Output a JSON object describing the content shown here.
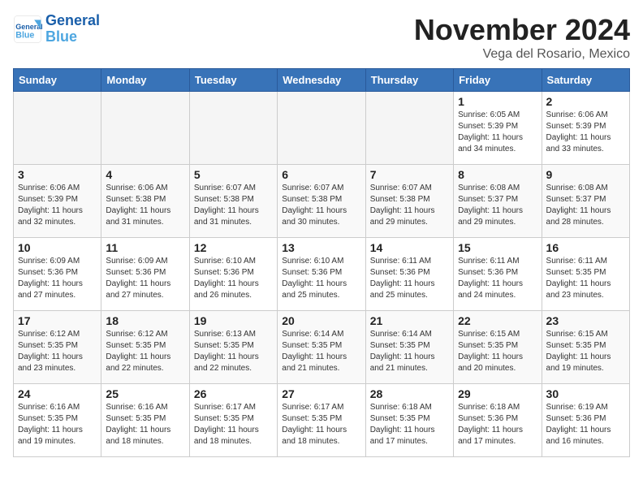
{
  "header": {
    "logo_line1": "General",
    "logo_line2": "Blue",
    "month_title": "November 2024",
    "location": "Vega del Rosario, Mexico"
  },
  "days_of_week": [
    "Sunday",
    "Monday",
    "Tuesday",
    "Wednesday",
    "Thursday",
    "Friday",
    "Saturday"
  ],
  "weeks": [
    {
      "row_class": "row-white",
      "days": [
        {
          "date": "",
          "empty": true
        },
        {
          "date": "",
          "empty": true
        },
        {
          "date": "",
          "empty": true
        },
        {
          "date": "",
          "empty": true
        },
        {
          "date": "",
          "empty": true
        },
        {
          "date": "1",
          "sunrise": "Sunrise: 6:05 AM",
          "sunset": "Sunset: 5:39 PM",
          "daylight": "Daylight: 11 hours and 34 minutes."
        },
        {
          "date": "2",
          "sunrise": "Sunrise: 6:06 AM",
          "sunset": "Sunset: 5:39 PM",
          "daylight": "Daylight: 11 hours and 33 minutes."
        }
      ]
    },
    {
      "row_class": "row-gray",
      "days": [
        {
          "date": "3",
          "sunrise": "Sunrise: 6:06 AM",
          "sunset": "Sunset: 5:39 PM",
          "daylight": "Daylight: 11 hours and 32 minutes."
        },
        {
          "date": "4",
          "sunrise": "Sunrise: 6:06 AM",
          "sunset": "Sunset: 5:38 PM",
          "daylight": "Daylight: 11 hours and 31 minutes."
        },
        {
          "date": "5",
          "sunrise": "Sunrise: 6:07 AM",
          "sunset": "Sunset: 5:38 PM",
          "daylight": "Daylight: 11 hours and 31 minutes."
        },
        {
          "date": "6",
          "sunrise": "Sunrise: 6:07 AM",
          "sunset": "Sunset: 5:38 PM",
          "daylight": "Daylight: 11 hours and 30 minutes."
        },
        {
          "date": "7",
          "sunrise": "Sunrise: 6:07 AM",
          "sunset": "Sunset: 5:38 PM",
          "daylight": "Daylight: 11 hours and 29 minutes."
        },
        {
          "date": "8",
          "sunrise": "Sunrise: 6:08 AM",
          "sunset": "Sunset: 5:37 PM",
          "daylight": "Daylight: 11 hours and 29 minutes."
        },
        {
          "date": "9",
          "sunrise": "Sunrise: 6:08 AM",
          "sunset": "Sunset: 5:37 PM",
          "daylight": "Daylight: 11 hours and 28 minutes."
        }
      ]
    },
    {
      "row_class": "row-white",
      "days": [
        {
          "date": "10",
          "sunrise": "Sunrise: 6:09 AM",
          "sunset": "Sunset: 5:36 PM",
          "daylight": "Daylight: 11 hours and 27 minutes."
        },
        {
          "date": "11",
          "sunrise": "Sunrise: 6:09 AM",
          "sunset": "Sunset: 5:36 PM",
          "daylight": "Daylight: 11 hours and 27 minutes."
        },
        {
          "date": "12",
          "sunrise": "Sunrise: 6:10 AM",
          "sunset": "Sunset: 5:36 PM",
          "daylight": "Daylight: 11 hours and 26 minutes."
        },
        {
          "date": "13",
          "sunrise": "Sunrise: 6:10 AM",
          "sunset": "Sunset: 5:36 PM",
          "daylight": "Daylight: 11 hours and 25 minutes."
        },
        {
          "date": "14",
          "sunrise": "Sunrise: 6:11 AM",
          "sunset": "Sunset: 5:36 PM",
          "daylight": "Daylight: 11 hours and 25 minutes."
        },
        {
          "date": "15",
          "sunrise": "Sunrise: 6:11 AM",
          "sunset": "Sunset: 5:36 PM",
          "daylight": "Daylight: 11 hours and 24 minutes."
        },
        {
          "date": "16",
          "sunrise": "Sunrise: 6:11 AM",
          "sunset": "Sunset: 5:35 PM",
          "daylight": "Daylight: 11 hours and 23 minutes."
        }
      ]
    },
    {
      "row_class": "row-gray",
      "days": [
        {
          "date": "17",
          "sunrise": "Sunrise: 6:12 AM",
          "sunset": "Sunset: 5:35 PM",
          "daylight": "Daylight: 11 hours and 23 minutes."
        },
        {
          "date": "18",
          "sunrise": "Sunrise: 6:12 AM",
          "sunset": "Sunset: 5:35 PM",
          "daylight": "Daylight: 11 hours and 22 minutes."
        },
        {
          "date": "19",
          "sunrise": "Sunrise: 6:13 AM",
          "sunset": "Sunset: 5:35 PM",
          "daylight": "Daylight: 11 hours and 22 minutes."
        },
        {
          "date": "20",
          "sunrise": "Sunrise: 6:14 AM",
          "sunset": "Sunset: 5:35 PM",
          "daylight": "Daylight: 11 hours and 21 minutes."
        },
        {
          "date": "21",
          "sunrise": "Sunrise: 6:14 AM",
          "sunset": "Sunset: 5:35 PM",
          "daylight": "Daylight: 11 hours and 21 minutes."
        },
        {
          "date": "22",
          "sunrise": "Sunrise: 6:15 AM",
          "sunset": "Sunset: 5:35 PM",
          "daylight": "Daylight: 11 hours and 20 minutes."
        },
        {
          "date": "23",
          "sunrise": "Sunrise: 6:15 AM",
          "sunset": "Sunset: 5:35 PM",
          "daylight": "Daylight: 11 hours and 19 minutes."
        }
      ]
    },
    {
      "row_class": "row-white",
      "days": [
        {
          "date": "24",
          "sunrise": "Sunrise: 6:16 AM",
          "sunset": "Sunset: 5:35 PM",
          "daylight": "Daylight: 11 hours and 19 minutes."
        },
        {
          "date": "25",
          "sunrise": "Sunrise: 6:16 AM",
          "sunset": "Sunset: 5:35 PM",
          "daylight": "Daylight: 11 hours and 18 minutes."
        },
        {
          "date": "26",
          "sunrise": "Sunrise: 6:17 AM",
          "sunset": "Sunset: 5:35 PM",
          "daylight": "Daylight: 11 hours and 18 minutes."
        },
        {
          "date": "27",
          "sunrise": "Sunrise: 6:17 AM",
          "sunset": "Sunset: 5:35 PM",
          "daylight": "Daylight: 11 hours and 18 minutes."
        },
        {
          "date": "28",
          "sunrise": "Sunrise: 6:18 AM",
          "sunset": "Sunset: 5:35 PM",
          "daylight": "Daylight: 11 hours and 17 minutes."
        },
        {
          "date": "29",
          "sunrise": "Sunrise: 6:18 AM",
          "sunset": "Sunset: 5:36 PM",
          "daylight": "Daylight: 11 hours and 17 minutes."
        },
        {
          "date": "30",
          "sunrise": "Sunrise: 6:19 AM",
          "sunset": "Sunset: 5:36 PM",
          "daylight": "Daylight: 11 hours and 16 minutes."
        }
      ]
    }
  ]
}
